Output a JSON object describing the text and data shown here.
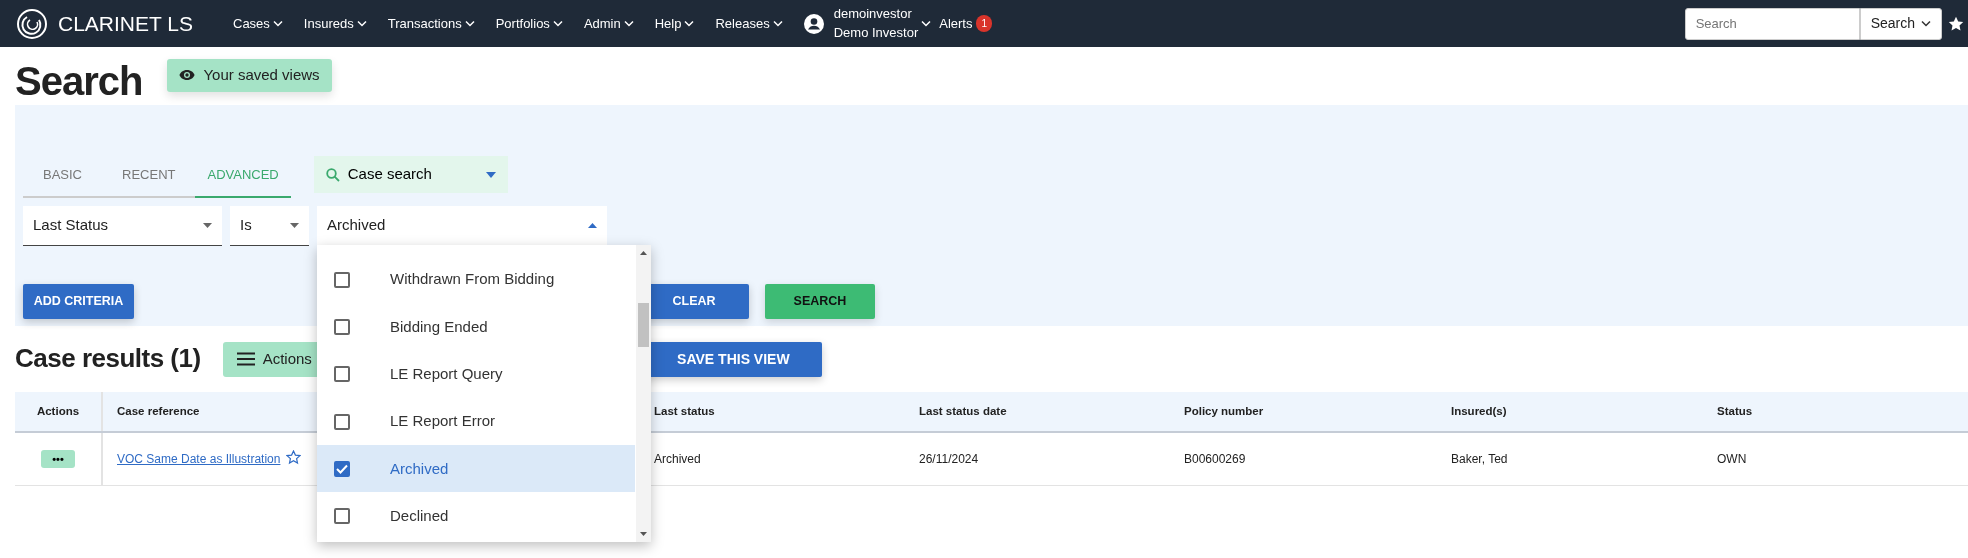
{
  "navbar": {
    "brand": "CLARINET LS",
    "menus": [
      {
        "label": "Cases"
      },
      {
        "label": "Insureds"
      },
      {
        "label": "Transactions"
      },
      {
        "label": "Portfolios"
      },
      {
        "label": "Admin"
      },
      {
        "label": "Help"
      },
      {
        "label": "Releases"
      }
    ],
    "user": {
      "username": "demoinvestor",
      "display_name": "Demo Investor"
    },
    "alerts": {
      "label": "Alerts",
      "count": "1"
    },
    "search": {
      "placeholder": "Search",
      "button": "Search"
    }
  },
  "page": {
    "title": "Search",
    "saved_views": "Your saved views"
  },
  "search_panel": {
    "tabs": [
      {
        "label": "BASIC",
        "selected": false
      },
      {
        "label": "RECENT",
        "selected": false
      },
      {
        "label": "ADVANCED",
        "selected": true
      }
    ],
    "search_type": "Case search",
    "criteria": {
      "field": "Last Status",
      "operator": "Is",
      "value": "Archived",
      "expanded": true
    },
    "options": [
      {
        "label": "Withdrawn From Bidding",
        "checked": false
      },
      {
        "label": "Bidding Ended",
        "checked": false
      },
      {
        "label": "LE Report Query",
        "checked": false
      },
      {
        "label": "LE Report Error",
        "checked": false
      },
      {
        "label": "Archived",
        "checked": true
      },
      {
        "label": "Declined",
        "checked": false
      }
    ],
    "add_button": "ADD CRITERIA",
    "clear_button": "CLEAR",
    "search_button": "SEARCH"
  },
  "results": {
    "title": "Case results (1)",
    "actions_button": "Actions",
    "save_button": "SAVE THIS VIEW",
    "columns": [
      "Actions",
      "Case reference",
      "Last status",
      "Last status date",
      "Policy number",
      "Insured(s)",
      "Status"
    ],
    "rows": [
      {
        "starred": false,
        "cells": [
          "•••",
          "VOC Same Date as Illustration",
          "Archived",
          "26/11/2024",
          "B00600269",
          "Baker, Ted",
          "OWN"
        ]
      }
    ]
  }
}
